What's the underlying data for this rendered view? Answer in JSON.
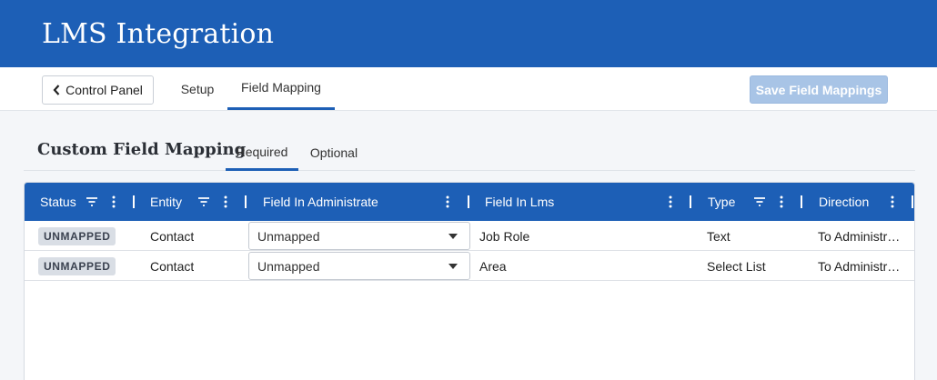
{
  "header": {
    "title": "LMS Integration"
  },
  "toolbar": {
    "back_label": "Control Panel",
    "tabs": [
      {
        "label": "Setup",
        "active": false
      },
      {
        "label": "Field Mapping",
        "active": true
      }
    ],
    "save_label": "Save Field Mappings"
  },
  "section": {
    "title": "Custom Field Mapping",
    "tabs": [
      {
        "label": "Required",
        "active": true
      },
      {
        "label": "Optional",
        "active": false
      }
    ]
  },
  "grid": {
    "columns": [
      "Status",
      "Entity",
      "Field In Administrate",
      "Field In Lms",
      "Type",
      "Direction"
    ],
    "rows": [
      {
        "status": "UNMAPPED",
        "entity": "Contact",
        "field_admin": "Unmapped",
        "field_lms": "Job Role",
        "type": "Text",
        "direction": "To Administr…"
      },
      {
        "status": "UNMAPPED",
        "entity": "Contact",
        "field_admin": "Unmapped",
        "field_lms": "Area",
        "type": "Select List",
        "direction": "To Administr…"
      }
    ]
  },
  "colors": {
    "primary": "#1d5fb6",
    "save_disabled": "#a8c4e6",
    "badge_bg": "#d9dee5"
  },
  "icons": [
    "chevron-left-icon",
    "filter-icon",
    "more-vert-icon",
    "caret-down-icon"
  ]
}
